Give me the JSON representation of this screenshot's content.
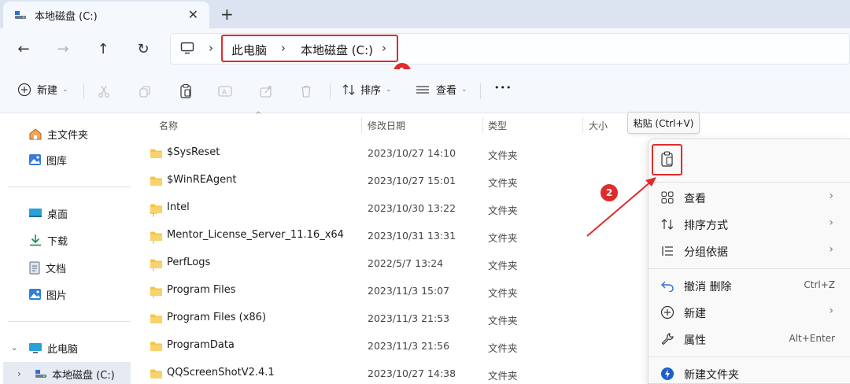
{
  "tab": {
    "title": "本地磁盘 (C:)",
    "close_glyph": "✕",
    "new_glyph": "+"
  },
  "nav": {
    "back": "←",
    "forward": "→",
    "up": "↑",
    "refresh": "↻"
  },
  "breadcrumb": {
    "items": [
      "此电脑",
      "本地磁盘 (C:)"
    ],
    "sep": "›"
  },
  "badges": {
    "one": "1",
    "two": "2"
  },
  "toolbar": {
    "new_label": "新建",
    "sort_label": "排序",
    "view_label": "查看",
    "more_label": "•••",
    "caret": "⌄"
  },
  "sidebar": {
    "quick": [
      {
        "label": "主文件夹",
        "icon": "home-icon"
      },
      {
        "label": "图库",
        "icon": "gallery-icon"
      }
    ],
    "pinned": [
      {
        "label": "桌面",
        "icon": "desktop-icon"
      },
      {
        "label": "下载",
        "icon": "download-icon"
      },
      {
        "label": "文档",
        "icon": "document-icon"
      },
      {
        "label": "图片",
        "icon": "pictures-icon"
      }
    ],
    "tree": [
      {
        "label": "此电脑",
        "icon": "pc-icon",
        "expander": "⌄"
      },
      {
        "label": "本地磁盘 (C:)",
        "icon": "drive-icon",
        "expander": "›"
      }
    ],
    "pin_glyph": "📌"
  },
  "columns": {
    "name": "名称",
    "date": "修改日期",
    "type": "类型",
    "size": "大小",
    "sort_caret": "^"
  },
  "files": [
    {
      "name": "$SysReset",
      "date": "2023/10/27 14:10",
      "type": "文件夹"
    },
    {
      "name": "$WinREAgent",
      "date": "2023/10/27 15:01",
      "type": "文件夹"
    },
    {
      "name": "Intel",
      "date": "2023/10/30 13:22",
      "type": "文件夹"
    },
    {
      "name": "Mentor_License_Server_11.16_x64",
      "date": "2023/10/31 13:31",
      "type": "文件夹"
    },
    {
      "name": "PerfLogs",
      "date": "2022/5/7 13:24",
      "type": "文件夹"
    },
    {
      "name": "Program Files",
      "date": "2023/11/3 15:07",
      "type": "文件夹"
    },
    {
      "name": "Program Files (x86)",
      "date": "2023/11/3 21:53",
      "type": "文件夹"
    },
    {
      "name": "ProgramData",
      "date": "2023/11/3 21:56",
      "type": "文件夹"
    },
    {
      "name": "QQScreenShotV2.4.1",
      "date": "2023/10/27 14:38",
      "type": "文件夹"
    }
  ],
  "tooltip": {
    "text": "粘贴 (Ctrl+V)"
  },
  "context_menu": {
    "items": [
      {
        "label": "查看",
        "icon": "grid-icon",
        "arrow": "›",
        "shortcut": ""
      },
      {
        "label": "排序方式",
        "icon": "sort-icon",
        "arrow": "›",
        "shortcut": ""
      },
      {
        "label": "分组依据",
        "icon": "group-icon",
        "arrow": "›",
        "shortcut": ""
      },
      {
        "label": "撤消 删除",
        "icon": "undo-icon",
        "arrow": "",
        "shortcut": "Ctrl+Z"
      },
      {
        "label": "新建",
        "icon": "plus-circle-icon",
        "arrow": "›",
        "shortcut": ""
      },
      {
        "label": "属性",
        "icon": "wrench-icon",
        "arrow": "",
        "shortcut": "Alt+Enter"
      },
      {
        "label": "新建文件夹",
        "icon": "new-folder-icon",
        "arrow": "",
        "shortcut": ""
      }
    ]
  },
  "colors": {
    "accent_red": "#e02b2b",
    "folder_yellow": "#f4c542",
    "titlebar": "#dbe4f0"
  }
}
